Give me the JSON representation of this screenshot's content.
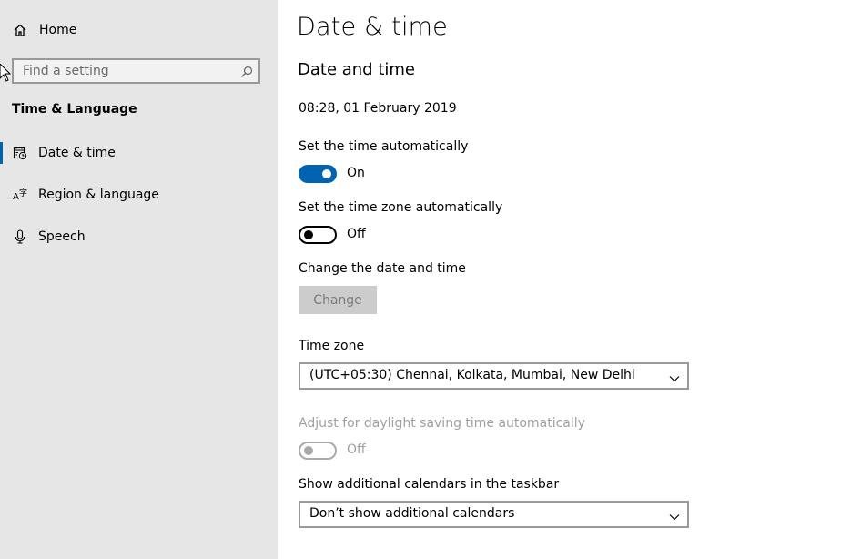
{
  "sidebar": {
    "home_label": "Home",
    "search_placeholder": "Find a setting",
    "section_title": "Time & Language",
    "items": [
      {
        "label": "Date & time",
        "icon": "calendar-clock-icon",
        "active": true
      },
      {
        "label": "Region & language",
        "icon": "language-icon",
        "active": false
      },
      {
        "label": "Speech",
        "icon": "microphone-icon",
        "active": false
      }
    ]
  },
  "main": {
    "page_title": "Date & time",
    "section_title": "Date and time",
    "current_datetime": "08:28, 01 February 2019",
    "auto_time": {
      "label": "Set the time automatically",
      "state": "On"
    },
    "auto_timezone": {
      "label": "Set the time zone automatically",
      "state": "Off"
    },
    "change_datetime": {
      "label": "Change the date and time",
      "button": "Change"
    },
    "time_zone": {
      "label": "Time zone",
      "value": "(UTC+05:30) Chennai, Kolkata, Mumbai, New Delhi"
    },
    "daylight": {
      "label": "Adjust for daylight saving time automatically",
      "state": "Off"
    },
    "calendars": {
      "label": "Show additional calendars in the taskbar",
      "value": "Don’t show additional calendars"
    }
  },
  "colors": {
    "accent": "#0063b1",
    "sidebar_bg": "#e6e6e6",
    "disabled_text": "#a0a0a0"
  }
}
